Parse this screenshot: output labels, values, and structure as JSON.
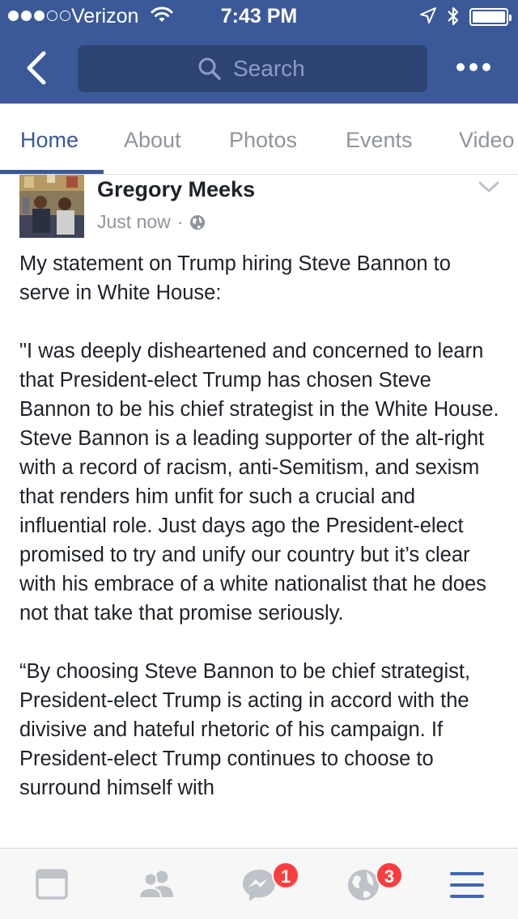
{
  "status_bar": {
    "carrier": "Verizon",
    "time": "7:43 PM",
    "signal_bars_filled": 3,
    "signal_bars_total": 5,
    "battery_level": 0.9
  },
  "header": {
    "back_icon": "chevron-left-icon",
    "search_placeholder": "Search",
    "more_icon": "more-dots-icon",
    "background_color": "#3b5998"
  },
  "tabs": [
    {
      "label": "Home",
      "active": true
    },
    {
      "label": "About",
      "active": false
    },
    {
      "label": "Photos",
      "active": false
    },
    {
      "label": "Events",
      "active": false
    },
    {
      "label": "Video",
      "active": false
    }
  ],
  "post": {
    "author": "Gregory Meeks",
    "timestamp": "Just now",
    "separator": "·",
    "privacy_icon": "globe-icon",
    "paragraphs": [
      "My statement on Trump hiring Steve Bannon to serve in White House:",
      "\"I was deeply disheartened and concerned to learn that President-elect Trump has chosen Steve Bannon to be his chief strategist in the White House. Steve Bannon is a leading supporter of the alt-right with a record of racism, anti-Semitism, and sexism that renders him unfit for such a crucial and influential role.  Just days ago the President-elect promised to try and unify our country but it’s clear with his embrace of a white nationalist that he does not that take that promise seriously.",
      "“By choosing Steve Bannon to be chief strategist, President-elect Trump is acting in accord with the divisive and hateful rhetoric of his campaign.  If President-elect Trump continues to choose to surround himself with"
    ]
  },
  "bottom_bar": {
    "items": [
      {
        "icon": "news-feed-icon"
      },
      {
        "icon": "friends-icon"
      },
      {
        "icon": "messenger-icon",
        "badge": "1"
      },
      {
        "icon": "notifications-globe-icon",
        "badge": "3"
      },
      {
        "icon": "menu-icon"
      }
    ],
    "active_color": "#4267b2",
    "badge_color": "#fa3e3e"
  }
}
